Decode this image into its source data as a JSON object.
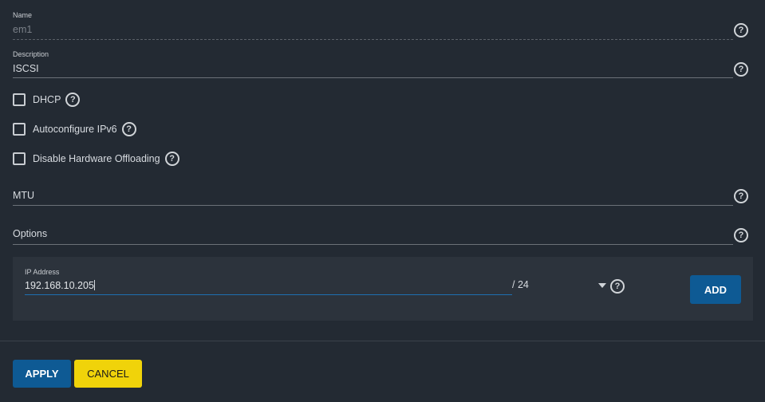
{
  "form": {
    "name": {
      "label": "Name",
      "value": "em1"
    },
    "description": {
      "label": "Description",
      "value": "ISCSI"
    },
    "dhcp": {
      "label": "DHCP",
      "checked": false
    },
    "autoconfigure_ipv6": {
      "label": "Autoconfigure IPv6",
      "checked": false
    },
    "disable_hw_offloading": {
      "label": "Disable Hardware Offloading",
      "checked": false
    },
    "mtu": {
      "placeholder": "MTU",
      "value": ""
    },
    "options": {
      "placeholder": "Options",
      "value": ""
    },
    "ip_address": {
      "label": "IP Address",
      "value": "192.168.10.205",
      "netmask": "/ 24",
      "add_label": "ADD"
    }
  },
  "actions": {
    "apply_label": "APPLY",
    "cancel_label": "CANCEL"
  },
  "icons": {
    "help": "help-circle-icon",
    "caret": "caret-down-icon"
  },
  "colors": {
    "background": "#232a33",
    "panel": "#2c333c",
    "primary": "#0e5a94",
    "warning": "#f0d30a"
  }
}
